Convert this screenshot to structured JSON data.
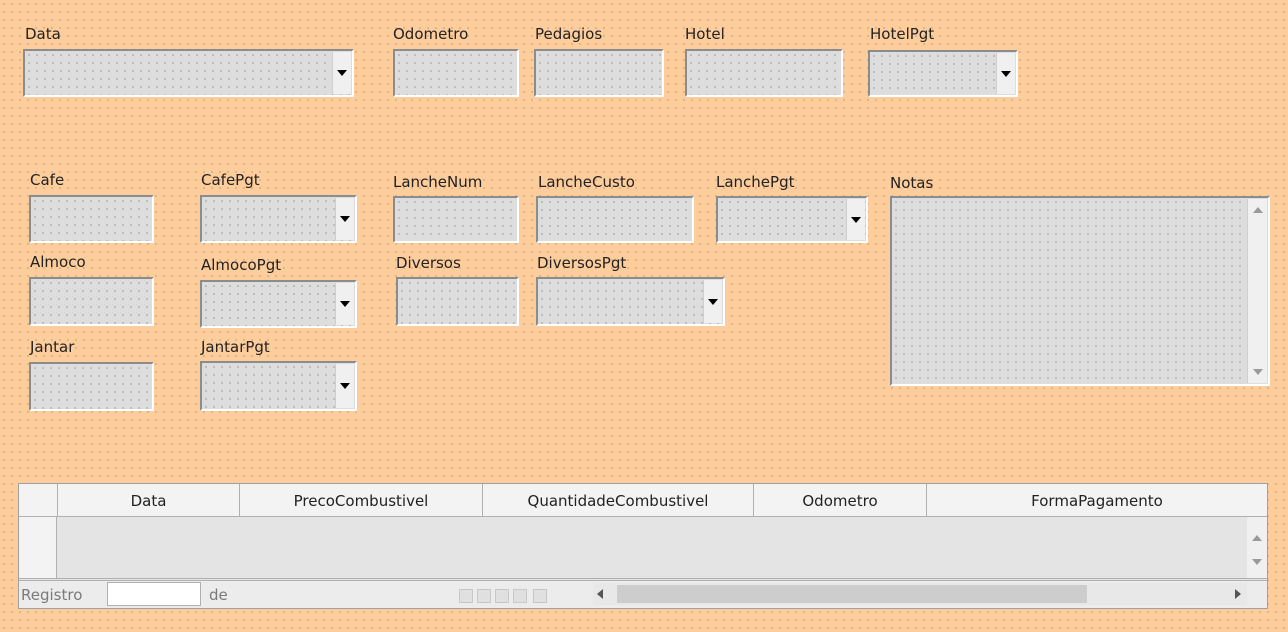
{
  "top_row": {
    "data_label": "Data",
    "odometro_label": "Odometro",
    "pedagios_label": "Pedagios",
    "hotel_label": "Hotel",
    "hotelpgt_label": "HotelPgt"
  },
  "middle": {
    "cafe_label": "Cafe",
    "cafepgt_label": "CafePgt",
    "lanchenum_label": "LancheNum",
    "lanchecusto_label": "LancheCusto",
    "lanchepgt_label": "LanchePgt",
    "notas_label": "Notas",
    "almoco_label": "Almoco",
    "almocopgt_label": "AlmocoPgt",
    "diversos_label": "Diversos",
    "diversospgt_label": "DiversosPgt",
    "jantar_label": "Jantar",
    "jantarpgt_label": "JantarPgt"
  },
  "grid": {
    "columns": [
      "Data",
      "PrecoCombustivel",
      "QuantidadeCombustivel",
      "Odometro",
      "FormaPagamento"
    ],
    "nav": {
      "record_label": "Registro",
      "record_value": "",
      "of_label": "de"
    }
  },
  "colors": {
    "background": "#fecd9c",
    "field": "#dddddd"
  }
}
